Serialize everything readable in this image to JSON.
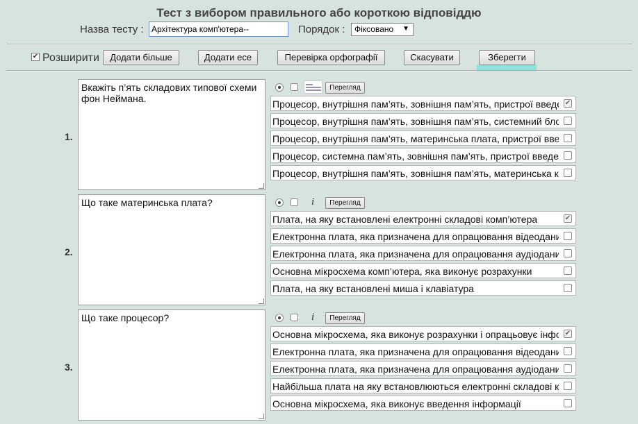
{
  "title": "Тест з вибором правильного або короткою відповіддю",
  "test_name": {
    "label": "Назва тесту :",
    "value": "Архітектура комп'ютера--"
  },
  "order": {
    "label": "Порядок :",
    "value": "Фіксовано"
  },
  "toolbar": {
    "expand_label": "Розширити",
    "expand_checked": true,
    "add_more": "Додати більше",
    "add_essay": "Додати есе",
    "spellcheck": "Перевірка орфографії",
    "cancel": "Скасувати",
    "save": "Зберегти"
  },
  "questions": [
    {
      "number": "1.",
      "text": "Вкажіть п’ять складових типової схеми фон Неймана.",
      "media": "image-icon",
      "preview": "Перегляд",
      "answers": [
        {
          "text": "Процесор, внутрішня пам’ять, зовнішня пам’ять, пристрої введення-виведення",
          "checked": true
        },
        {
          "text": "Процесор, внутрішня пам’ять, зовнішня пам’ять, системний блок",
          "checked": false
        },
        {
          "text": "Процесор, внутрішня пам’ять, материнська плата, пристрої введення",
          "checked": false
        },
        {
          "text": "Процесор, системна пам’ять, зовнішня пам’ять, пристрої введення",
          "checked": false
        },
        {
          "text": "Процесор, внутрішня пам’ять, зовнішня пам’ять, материнська карта",
          "checked": false
        }
      ]
    },
    {
      "number": "2.",
      "text": "Що таке материнська плата?",
      "media": "i",
      "preview": "Перегляд",
      "answers": [
        {
          "text": "Плата, на яку встановлені електронні складові комп’ютера",
          "checked": true
        },
        {
          "text": "Електронна плата, яка призначена для опрацювання відеоданих",
          "checked": false
        },
        {
          "text": "Електронна плата, яка призначена для опрацювання аудіоданих",
          "checked": false
        },
        {
          "text": "Основна мікросхема комп’ютера, яка виконує розрахунки",
          "checked": false
        },
        {
          "text": "Плата, на яку встановлені миша і клавіатура",
          "checked": false
        }
      ]
    },
    {
      "number": "3.",
      "text": "Що таке процесор?",
      "media": "i",
      "preview": "Перегляд",
      "answers": [
        {
          "text": "Основна мікросхема, яка виконує розрахунки і опрацьовує інформацію",
          "checked": true
        },
        {
          "text": "Електронна плата, яка призначена для опрацювання відеоданих",
          "checked": false
        },
        {
          "text": "Електронна плата, яка призначена для опрацювання аудіоданих",
          "checked": false
        },
        {
          "text": "Найбільша плата на яку встановлюються електронні складові комп’ютера",
          "checked": false
        },
        {
          "text": "Основна мікросхема, яка виконує введення інформації",
          "checked": false
        }
      ]
    }
  ]
}
